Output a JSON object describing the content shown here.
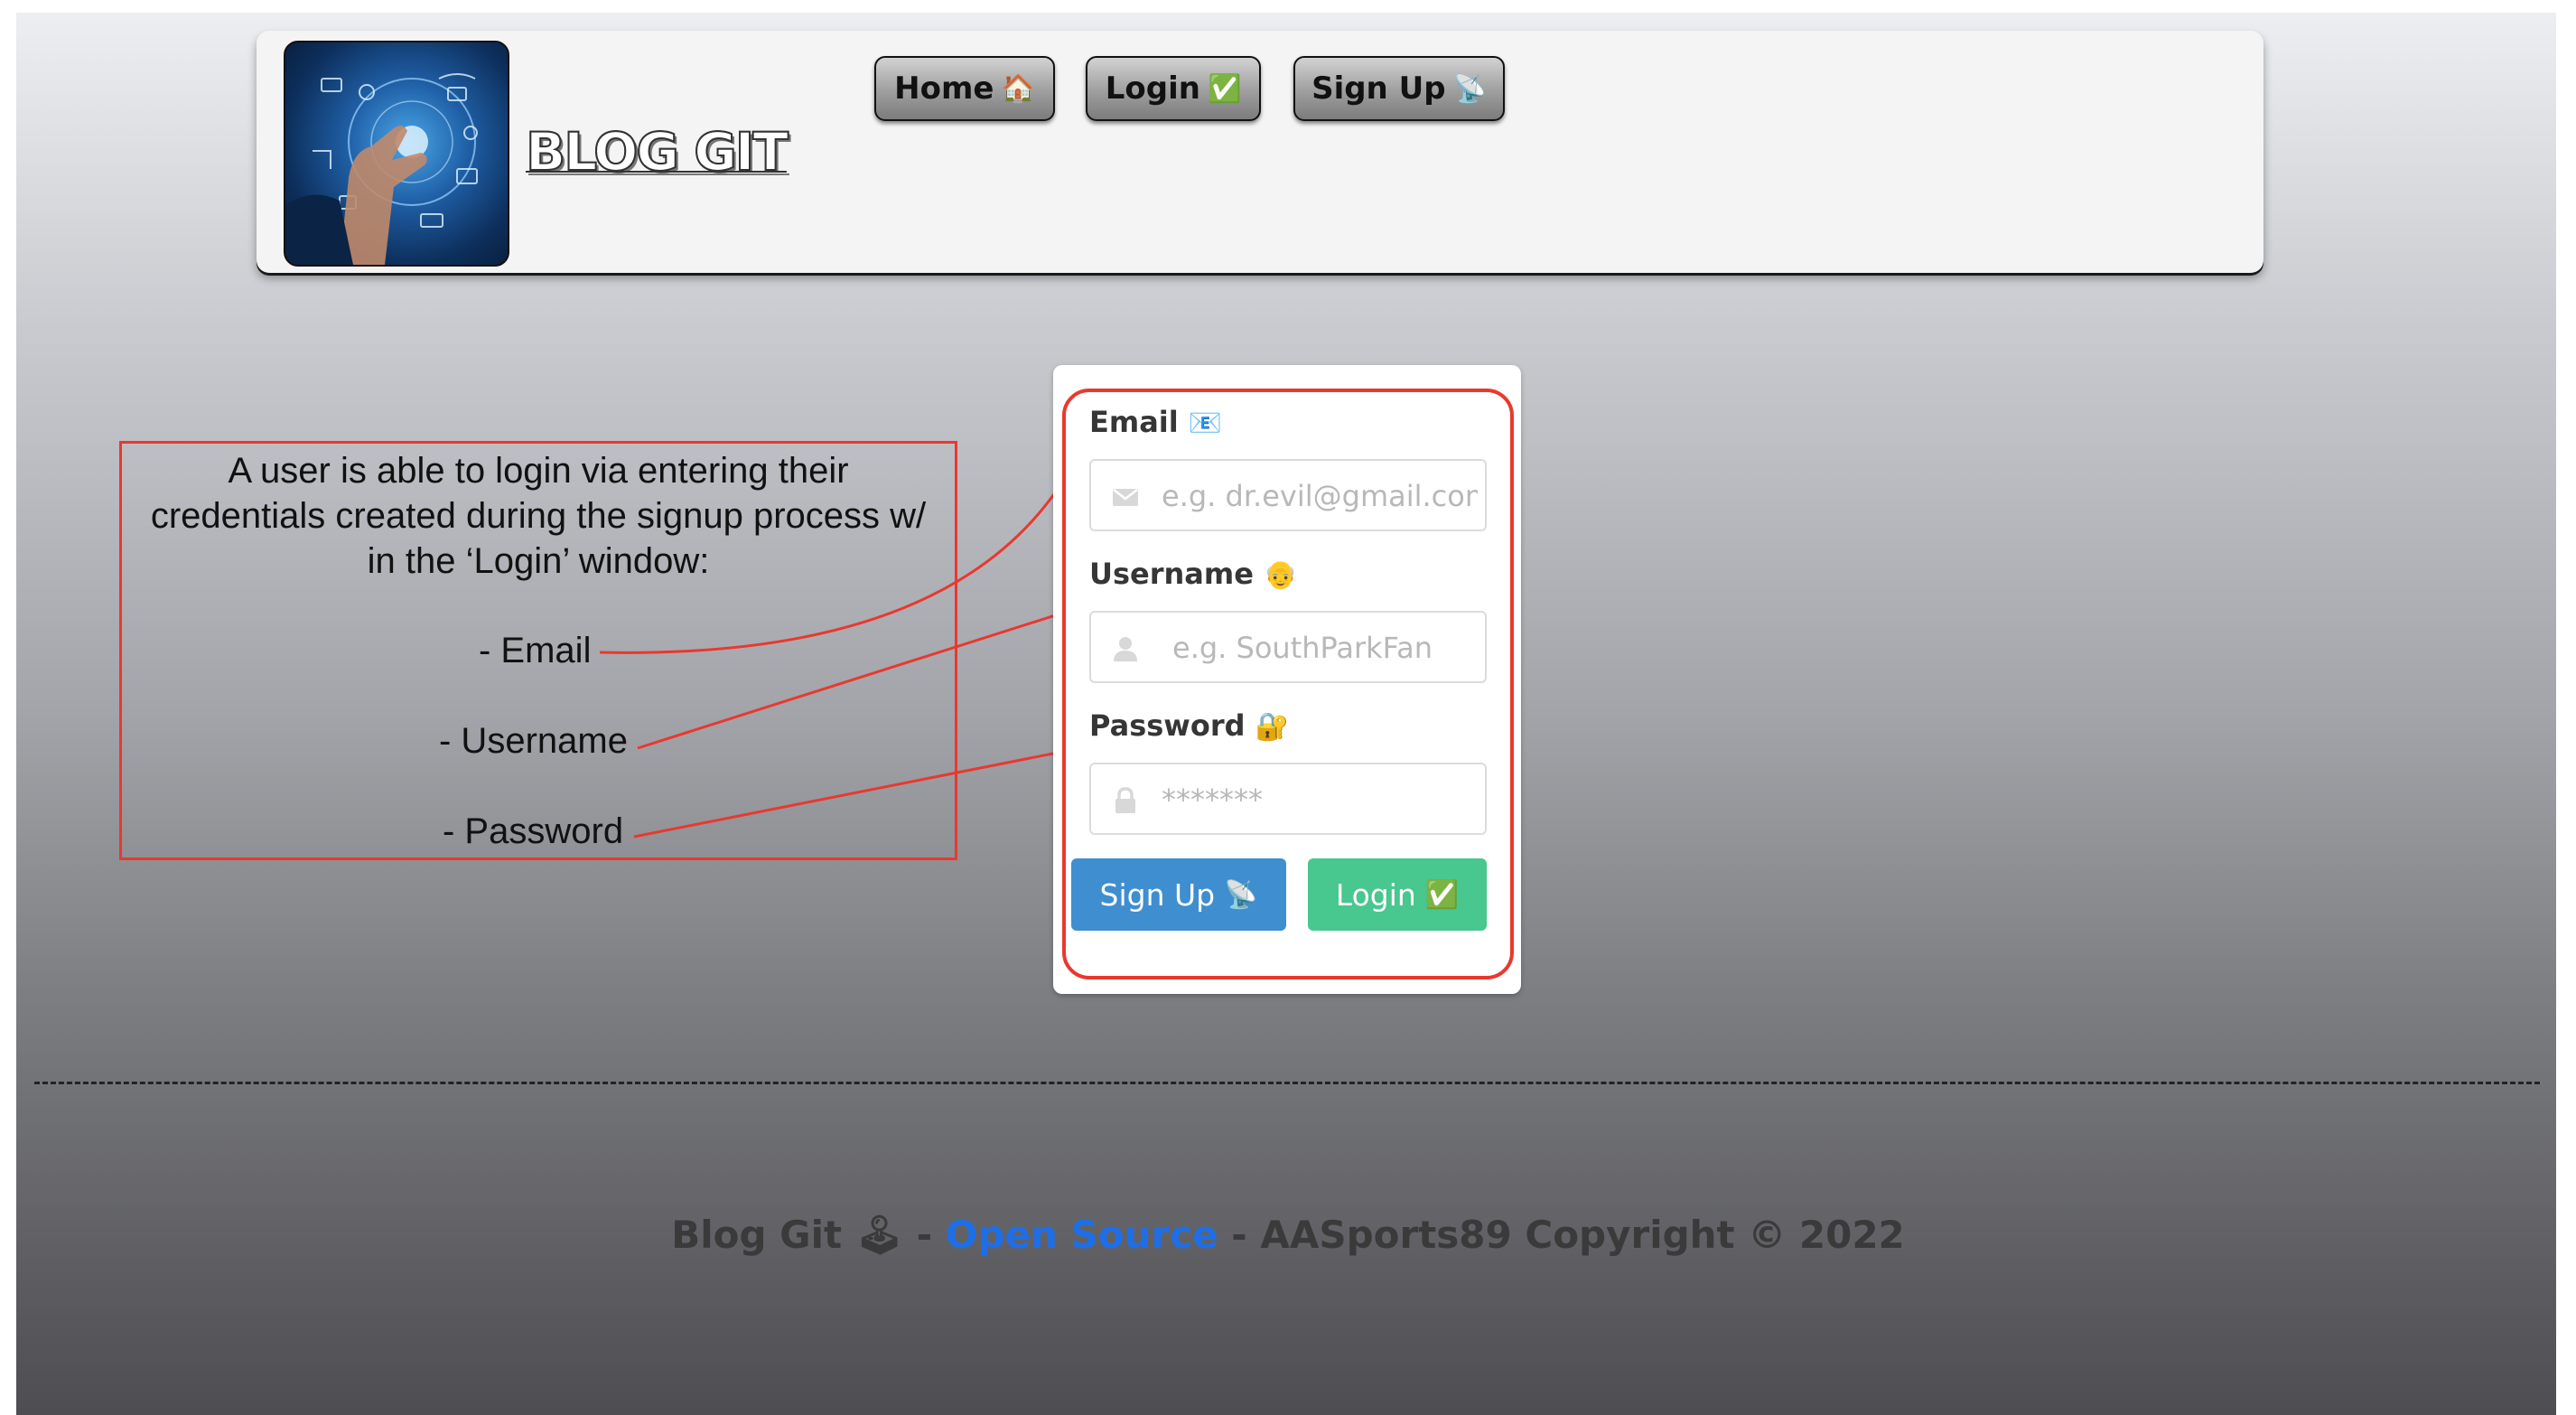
{
  "header": {
    "logo_text": "BLOG GIT",
    "nav": [
      {
        "label": "Home",
        "emoji": "🏠"
      },
      {
        "label": "Login",
        "emoji": "✅"
      },
      {
        "label": "Sign Up",
        "emoji": "📡"
      }
    ]
  },
  "annotation": {
    "text_line1": "A user is able to login via entering their",
    "text_line2": "credentials created during the signup process w/",
    "text_line3": "in the ‘Login’ window:",
    "items": [
      "- Email",
      "- Username",
      "- Password"
    ]
  },
  "login_form": {
    "email": {
      "label": "Email",
      "emoji": "📧",
      "placeholder": "e.g. dr.evil@gmail.com",
      "icon": "envelope-icon"
    },
    "username": {
      "label": "Username",
      "emoji": "👴",
      "placeholder": "e.g. SouthParkFan",
      "icon": "user-icon"
    },
    "password": {
      "label": "Password",
      "emoji": "🔐",
      "placeholder": "*******",
      "icon": "lock-icon"
    },
    "signup_button": {
      "label": "Sign Up",
      "emoji": "📡",
      "color": "#3e8ed0"
    },
    "login_button": {
      "label": "Login",
      "emoji": "✅",
      "color": "#48c78e"
    }
  },
  "footer": {
    "brand": "Blog Git",
    "brand_emoji": "🕹",
    "sep1": " - ",
    "link": "Open Source",
    "sep2": " - ",
    "copyright": "AASports89 Copyright © 2022"
  },
  "colors": {
    "annotation_red": "#e8392f",
    "link_blue": "#1e6ee8"
  }
}
